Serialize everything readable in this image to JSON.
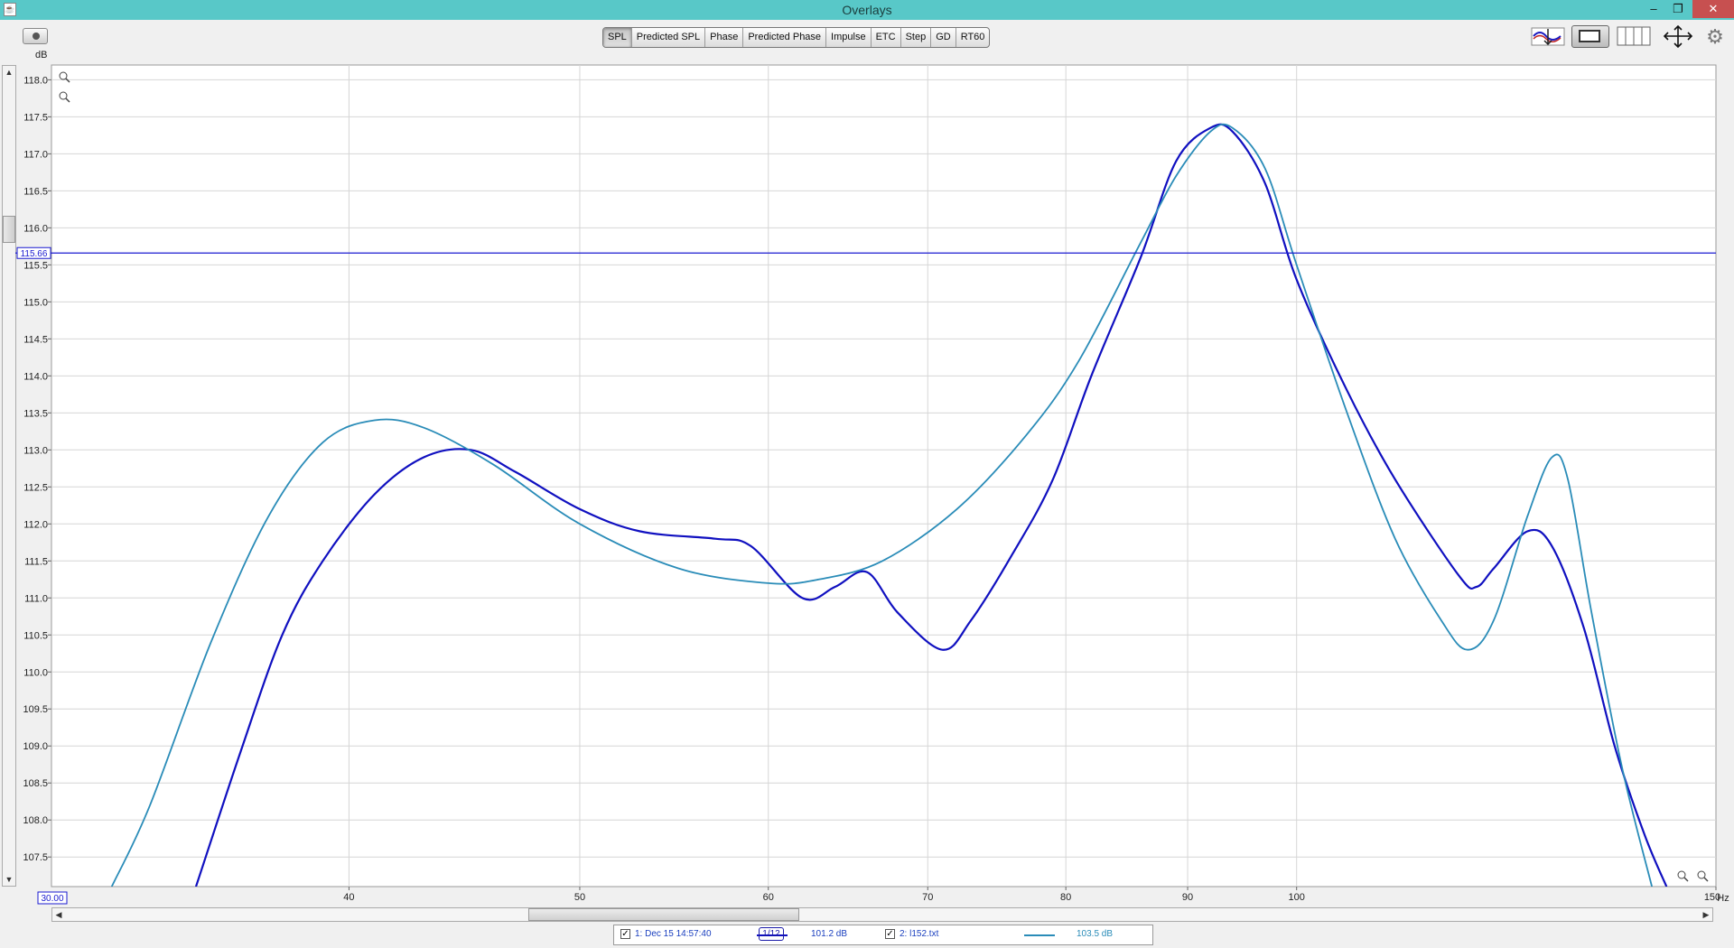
{
  "window": {
    "title": "Overlays",
    "app_icon": "java-icon",
    "minimize": "–",
    "maximize": "❐",
    "close": "✕"
  },
  "toolbar": {
    "tabs": [
      {
        "label": "SPL",
        "active": true
      },
      {
        "label": "Predicted SPL",
        "active": false
      },
      {
        "label": "Phase",
        "active": false
      },
      {
        "label": "Predicted Phase",
        "active": false
      },
      {
        "label": "Impulse",
        "active": false
      },
      {
        "label": "ETC",
        "active": false
      },
      {
        "label": "Step",
        "active": false
      },
      {
        "label": "GD",
        "active": false
      },
      {
        "label": "RT60",
        "active": false
      }
    ],
    "left_icon": "camera-icon",
    "right_icons": [
      "overlay-arrows-icon",
      "window-icon",
      "columns-icon",
      "move-arrows-icon",
      "gear-icon"
    ]
  },
  "axis": {
    "y_unit": "dB",
    "x_unit": "Hz",
    "x_start_value": "30.00",
    "cursor_value": "115.66"
  },
  "chart_data": {
    "type": "line",
    "xscale": "log",
    "xlim": [
      30,
      150
    ],
    "ylim": [
      107.1,
      118.2
    ],
    "x_ticks": [
      40,
      50,
      60,
      70,
      80,
      90,
      100,
      150
    ],
    "y_ticks": [
      107.5,
      108.0,
      108.5,
      109.0,
      109.5,
      110.0,
      110.5,
      111.0,
      111.5,
      112.0,
      112.5,
      113.0,
      113.5,
      114.0,
      114.5,
      115.0,
      115.5,
      116.0,
      116.5,
      117.0,
      117.5,
      118.0
    ],
    "cursor_y": 115.66,
    "grid": true,
    "series": [
      {
        "name": "1: Dec 15 14:57:40",
        "color": "#1010c0",
        "points": [
          [
            34.5,
            107.1
          ],
          [
            36,
            108.9
          ],
          [
            37.5,
            110.5
          ],
          [
            39,
            111.5
          ],
          [
            41,
            112.4
          ],
          [
            43,
            112.9
          ],
          [
            45,
            113.0
          ],
          [
            47,
            112.7
          ],
          [
            50,
            112.2
          ],
          [
            53,
            111.9
          ],
          [
            57,
            111.8
          ],
          [
            59,
            111.7
          ],
          [
            62,
            111.0
          ],
          [
            64,
            111.15
          ],
          [
            66,
            111.35
          ],
          [
            68,
            110.8
          ],
          [
            71,
            110.3
          ],
          [
            73,
            110.7
          ],
          [
            76,
            111.6
          ],
          [
            79,
            112.6
          ],
          [
            82,
            114.0
          ],
          [
            86,
            115.6
          ],
          [
            89,
            116.9
          ],
          [
            92,
            117.35
          ],
          [
            94,
            117.3
          ],
          [
            97,
            116.6
          ],
          [
            100,
            115.3
          ],
          [
            105,
            113.8
          ],
          [
            110,
            112.6
          ],
          [
            117,
            111.3
          ],
          [
            119,
            111.15
          ],
          [
            121,
            111.4
          ],
          [
            125,
            111.9
          ],
          [
            128,
            111.7
          ],
          [
            132,
            110.6
          ],
          [
            136,
            109.0
          ],
          [
            140,
            107.8
          ],
          [
            143,
            107.1
          ]
        ]
      },
      {
        "name": "2: l152.txt",
        "color": "#2a8cb8",
        "points": [
          [
            31.8,
            107.1
          ],
          [
            33,
            108.2
          ],
          [
            35,
            110.4
          ],
          [
            37,
            112.1
          ],
          [
            39,
            113.1
          ],
          [
            41,
            113.4
          ],
          [
            43,
            113.3
          ],
          [
            46,
            112.8
          ],
          [
            50,
            112.0
          ],
          [
            55,
            111.4
          ],
          [
            60,
            111.2
          ],
          [
            63,
            111.25
          ],
          [
            67,
            111.5
          ],
          [
            72,
            112.2
          ],
          [
            77,
            113.2
          ],
          [
            81,
            114.2
          ],
          [
            86,
            115.8
          ],
          [
            89,
            116.7
          ],
          [
            92,
            117.3
          ],
          [
            94,
            117.35
          ],
          [
            97,
            116.8
          ],
          [
            100,
            115.5
          ],
          [
            105,
            113.5
          ],
          [
            110,
            111.8
          ],
          [
            115,
            110.7
          ],
          [
            118,
            110.3
          ],
          [
            121,
            110.7
          ],
          [
            125,
            112.1
          ],
          [
            128,
            112.9
          ],
          [
            130,
            112.6
          ],
          [
            133,
            110.8
          ],
          [
            137,
            108.7
          ],
          [
            141,
            107.1
          ]
        ]
      }
    ]
  },
  "legend": {
    "items": [
      {
        "label": "1: Dec 15 14:57:40",
        "checked": true,
        "smoothing": "1/12",
        "level": "101.2 dB",
        "color": "#1010c0"
      },
      {
        "label": "2: l152.txt",
        "checked": true,
        "smoothing": "",
        "level": "103.5 dB",
        "color": "#2a8cb8"
      }
    ]
  }
}
